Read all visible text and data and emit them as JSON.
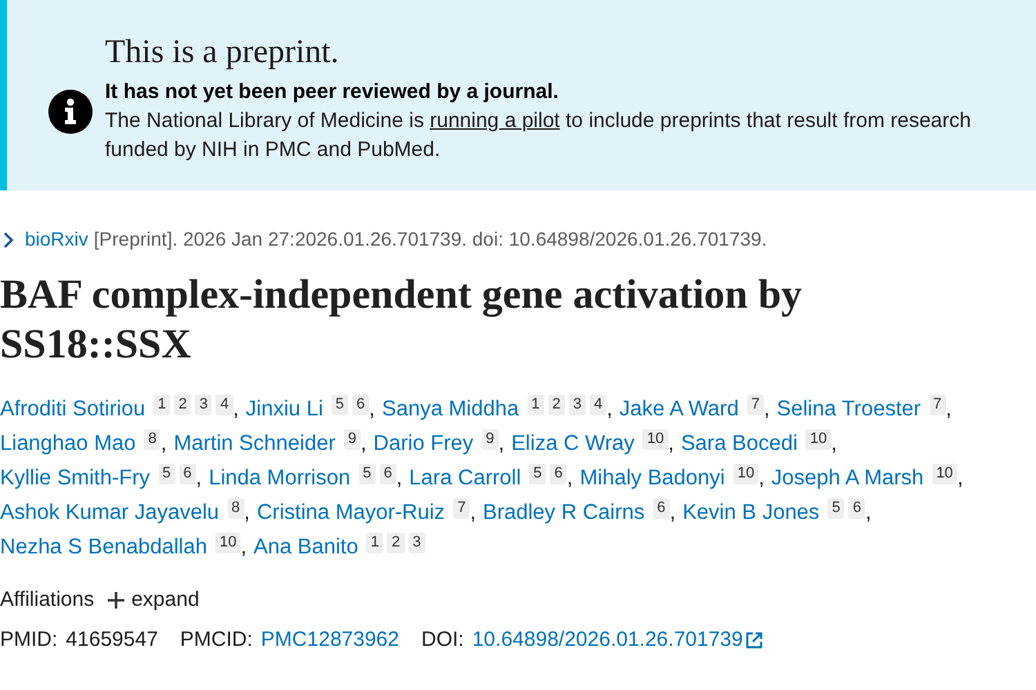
{
  "banner": {
    "title": "This is a preprint.",
    "subtitle": "It has not yet been peer reviewed by a journal.",
    "body_before": "The National Library of Medicine is",
    "body_link": "running a pilot",
    "body_after": "to include preprints that result from research funded by NIH in PMC and PubMed."
  },
  "citation": {
    "source": "bioRxiv",
    "text": "[Preprint]. 2026 Jan 27:2026.01.26.701739. doi: 10.64898/2026.01.26.701739."
  },
  "title": "BAF complex-independent gene activation by SS18::SSX",
  "author_lines": [
    [
      {
        "name": "Afroditi Sotiriou",
        "affiliations": [
          "1",
          "2",
          "3",
          "4"
        ],
        "separator": ","
      },
      {
        "name": "Jinxiu Li",
        "affiliations": [
          "5",
          "6"
        ],
        "separator": ","
      },
      {
        "name": "Sanya Middha",
        "affiliations": [
          "1",
          "2",
          "3",
          "4"
        ],
        "separator": ","
      },
      {
        "name": "Jake A Ward",
        "affiliations": [
          "7"
        ],
        "separator": ","
      },
      {
        "name": "Selina Troester",
        "affiliations": [
          "7"
        ],
        "separator": ","
      }
    ],
    [
      {
        "name": "Lianghao Mao",
        "affiliations": [
          "8"
        ],
        "separator": ","
      },
      {
        "name": "Martin Schneider",
        "affiliations": [
          "9"
        ],
        "separator": ","
      },
      {
        "name": "Dario Frey",
        "affiliations": [
          "9"
        ],
        "separator": ","
      },
      {
        "name": "Eliza C Wray",
        "affiliations": [
          "10"
        ],
        "separator": ","
      },
      {
        "name": "Sara Bocedi",
        "affiliations": [
          "10"
        ],
        "separator": ","
      }
    ],
    [
      {
        "name": "Kyllie Smith-Fry",
        "affiliations": [
          "5",
          "6"
        ],
        "separator": ","
      },
      {
        "name": "Linda Morrison",
        "affiliations": [
          "5",
          "6"
        ],
        "separator": ","
      },
      {
        "name": "Lara Carroll",
        "affiliations": [
          "5",
          "6"
        ],
        "separator": ","
      },
      {
        "name": "Mihaly Badonyi",
        "affiliations": [
          "10"
        ],
        "separator": ","
      },
      {
        "name": "Joseph A Marsh",
        "affiliations": [
          "10"
        ],
        "separator": ","
      }
    ],
    [
      {
        "name": "Ashok Kumar Jayavelu",
        "affiliations": [
          "8"
        ],
        "separator": ","
      },
      {
        "name": "Cristina Mayor-Ruiz",
        "affiliations": [
          "7"
        ],
        "separator": ","
      },
      {
        "name": "Bradley R Cairns",
        "affiliations": [
          "6"
        ],
        "separator": ","
      },
      {
        "name": "Kevin B Jones",
        "affiliations": [
          "5",
          "6"
        ],
        "separator": ","
      }
    ],
    [
      {
        "name": "Nezha S Benabdallah",
        "affiliations": [
          "10"
        ],
        "separator": ","
      },
      {
        "name": "Ana Banito",
        "affiliations": [
          "1",
          "2",
          "3"
        ]
      }
    ]
  ],
  "affiliations": {
    "label": "Affiliations",
    "toggle": "expand"
  },
  "ids": [
    {
      "kind": "text",
      "label": "PMID:",
      "value": "41659547"
    },
    {
      "kind": "link",
      "label": "PMCID:",
      "value": "PMC12873962"
    },
    {
      "kind": "external_link",
      "label": "DOI:",
      "value": "10.64898/2026.01.26.701739"
    }
  ]
}
